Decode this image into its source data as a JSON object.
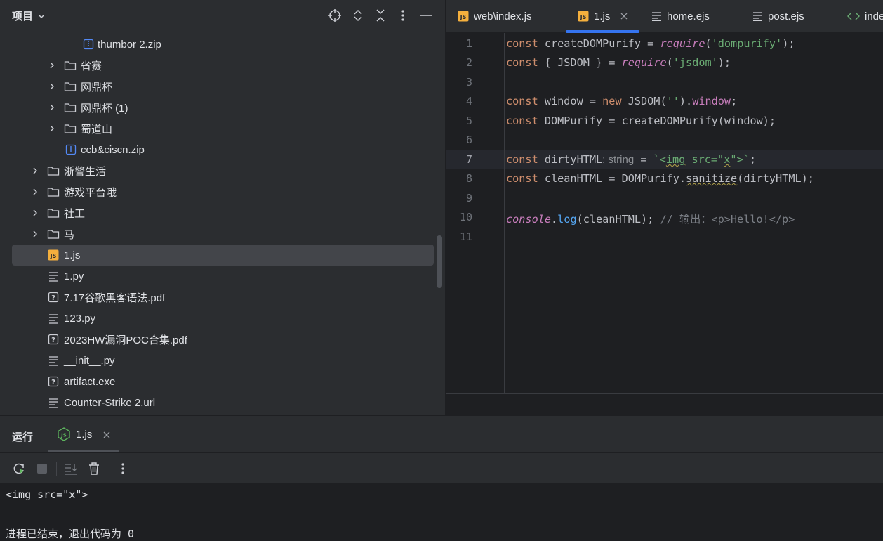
{
  "project": {
    "title": "项目",
    "tree": [
      {
        "label": "thumbor 2.zip",
        "type": "zip",
        "expandable": false
      },
      {
        "label": "省赛",
        "type": "folder",
        "expandable": true
      },
      {
        "label": "网鼎杯",
        "type": "folder",
        "expandable": true
      },
      {
        "label": "网鼎杯 (1)",
        "type": "folder",
        "expandable": true
      },
      {
        "label": "蜀道山",
        "type": "folder",
        "expandable": true
      },
      {
        "label": "ccb&ciscn.zip",
        "type": "zip",
        "expandable": false
      },
      {
        "label": "浙警生活",
        "type": "folder",
        "expandable": true
      },
      {
        "label": "游戏平台哦",
        "type": "folder",
        "expandable": true
      },
      {
        "label": "社工",
        "type": "folder",
        "expandable": true
      },
      {
        "label": "马",
        "type": "folder",
        "expandable": true
      },
      {
        "label": "1.js",
        "type": "js",
        "expandable": false,
        "selected": true
      },
      {
        "label": "1.py",
        "type": "text",
        "expandable": false
      },
      {
        "label": "7.17谷歌黑客语法.pdf",
        "type": "unknown",
        "expandable": false
      },
      {
        "label": "123.py",
        "type": "text",
        "expandable": false
      },
      {
        "label": "2023HW漏洞POC合集.pdf",
        "type": "unknown",
        "expandable": false
      },
      {
        "label": "__init__.py",
        "type": "text",
        "expandable": false
      },
      {
        "label": "artifact.exe",
        "type": "unknown",
        "expandable": false
      },
      {
        "label": "Counter-Strike 2.url",
        "type": "text",
        "expandable": false
      }
    ]
  },
  "editor": {
    "tabs": [
      {
        "label": "web\\index.js",
        "icon": "js-file-icon",
        "active": false
      },
      {
        "label": "1.js",
        "icon": "js-file-icon",
        "active": true,
        "closable": true
      },
      {
        "label": "home.ejs",
        "icon": "text-file-icon",
        "active": false
      },
      {
        "label": "post.ejs",
        "icon": "text-file-icon",
        "active": false
      },
      {
        "label": "inde",
        "icon": "html-file-icon",
        "active": false
      }
    ],
    "line_numbers": [
      "1",
      "2",
      "3",
      "4",
      "5",
      "6",
      "7",
      "8",
      "9",
      "10",
      "11"
    ],
    "current_line": 7,
    "code": {
      "l1": {
        "kw": "const",
        "name": " createDOMPurify = ",
        "call": "require",
        "p1": "(",
        "str": "'dompurify'",
        "end": ");"
      },
      "l2": {
        "kw": "const",
        "name": " { JSDOM } = ",
        "call": "require",
        "p1": "(",
        "str": "'jsdom'",
        "end": ");"
      },
      "l4": {
        "kw": "const",
        "a": " window = ",
        "kw2": "new",
        "b": " JSDOM(",
        "str": "''",
        "c": ").",
        "mem": "window",
        "end": ";"
      },
      "l5": {
        "kw": "const",
        "a": " DOMPurify = createDOMPurify(window);"
      },
      "l7": {
        "kw": "const",
        "a": " dirtyHTML",
        "hint": ": string",
        "b": " = ",
        "s1": "`<",
        "s2": "img",
        "s3": " src=\"",
        "s4": "x",
        "s5": "\">`",
        "end": ";"
      },
      "l8": {
        "kw": "const",
        "a": " cleanHTML = DOMPurify.",
        "m": "sanitize",
        "b": "(dirtyHTML);"
      },
      "l10": {
        "obj": "console",
        "dot": ".",
        "fn": "log",
        "a": "(cleanHTML); ",
        "cmt": "// 输出：<p>Hello!</p>"
      }
    }
  },
  "run": {
    "title": "运行",
    "tab_label": "1.js",
    "output": [
      "<img src=\"x\">",
      "",
      "进程已结束，退出代码为 0"
    ]
  }
}
